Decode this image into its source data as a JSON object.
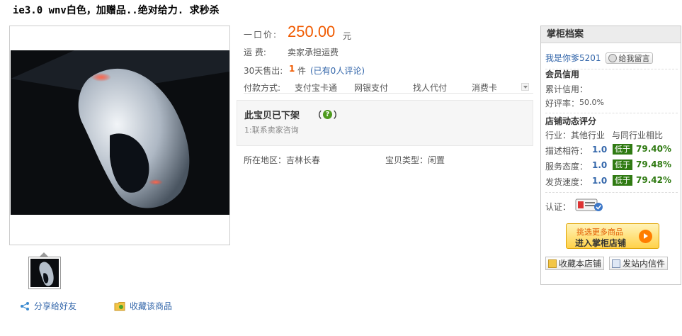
{
  "title": "ie3.0 wnv白色，加赠品..绝对给力. 求秒杀",
  "gallery": {
    "main_image_alt": "white mouse",
    "actions": {
      "share": "分享给好友",
      "favorite": "收藏该商品"
    }
  },
  "product": {
    "price_label": "一口价:",
    "price": "250.00",
    "price_unit": "元",
    "shipping_label": "运    费:",
    "shipping_value": "卖家承担运费",
    "sold_label": "30天售出:",
    "sold_count": "1",
    "sold_unit": "件",
    "review_text": "(已有0人评论)",
    "payment_label": "付款方式:",
    "payment_methods": [
      "支付宝卡通",
      "网银支付",
      "找人代付",
      "消费卡"
    ],
    "offline_title": "此宝贝已下架",
    "offline_tip": "1:联系卖家咨询",
    "region_label": "所在地区：",
    "region_value": "吉林长春",
    "type_label": "宝贝类型：",
    "type_value": "闲置"
  },
  "shop": {
    "header": "掌柜档案",
    "seller_name": "我是你爹5201",
    "message_button": "给我留言",
    "member_credit_title": "会员信用",
    "credit_label": "累计信用：",
    "positive_rate_label": "好评率：",
    "positive_rate": "50.0%",
    "dsr_title": "店铺动态评分",
    "dsr_header_left": "行业：其他行业",
    "dsr_header_right": "与同行业相比",
    "ratings": [
      {
        "label": "描述相符：",
        "score": "1.0",
        "badge": "低于",
        "pct": "79.40%"
      },
      {
        "label": "服务态度：",
        "score": "1.0",
        "badge": "低于",
        "pct": "79.48%"
      },
      {
        "label": "发货速度：",
        "score": "1.0",
        "badge": "低于",
        "pct": "79.42%"
      }
    ],
    "cert_label": "认证：",
    "enter_line1": "挑选更多商品",
    "enter_line2": "进入掌柜店铺",
    "fav_shop": "收藏本店铺",
    "send_msg": "发站内信件"
  },
  "colors": {
    "price": "#f05a00",
    "link": "#3366aa",
    "rating_badge": "#2f7a12"
  }
}
